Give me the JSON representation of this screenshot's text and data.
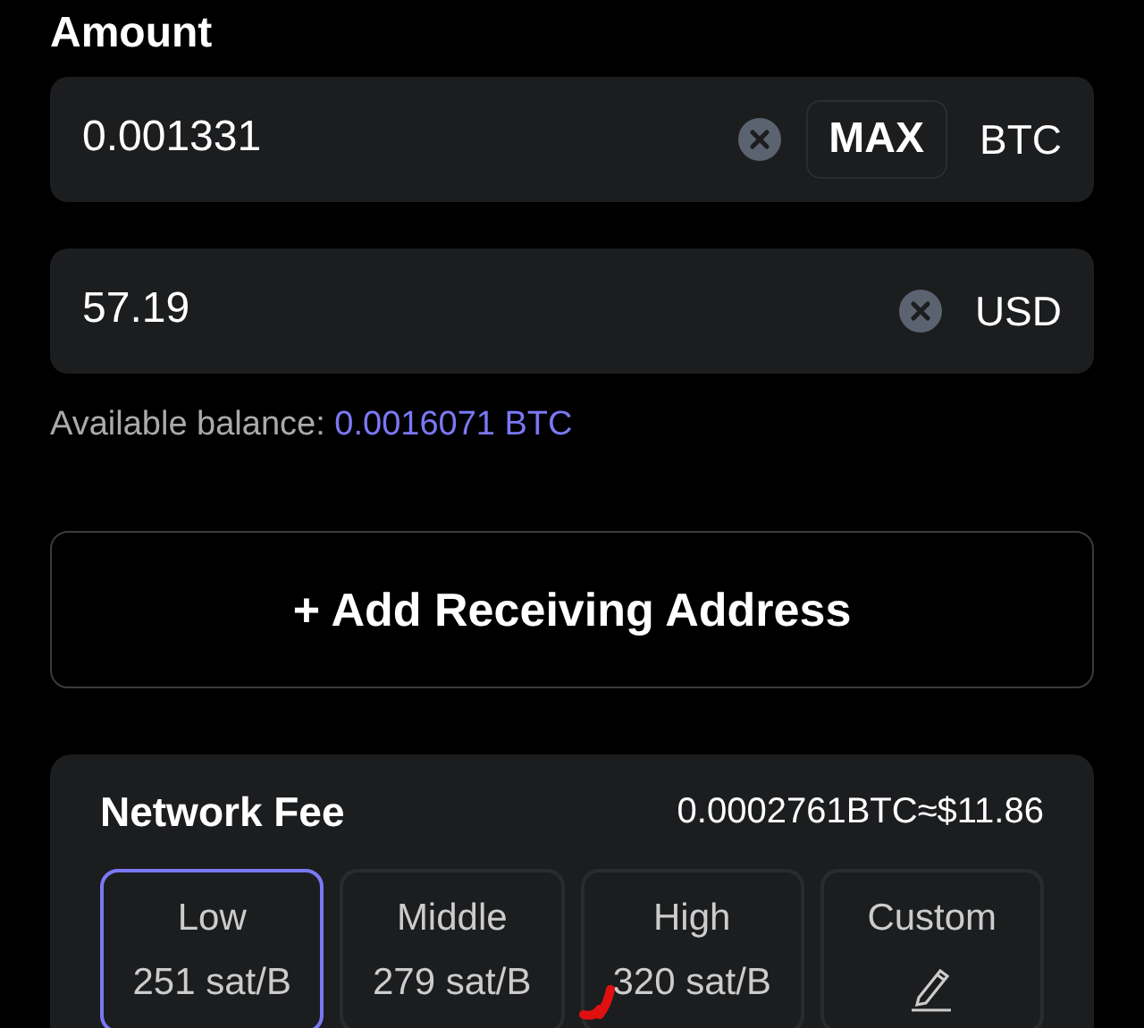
{
  "amount": {
    "title": "Amount",
    "fields": [
      {
        "value": "0.001331",
        "max_button": "MAX",
        "unit": "BTC"
      },
      {
        "value": "57.19",
        "unit": "USD"
      }
    ],
    "balance_label": "Available balance: ",
    "balance_value": "0.0016071 BTC"
  },
  "add_address_button": "+ Add Receiving Address",
  "network_fee": {
    "title": "Network Fee",
    "total": "0.0002761BTC≈$11.86",
    "options": [
      {
        "kind": "preset",
        "label": "Low",
        "rate": "251 sat/B",
        "selected": true
      },
      {
        "kind": "preset",
        "label": "Middle",
        "rate": "279 sat/B",
        "selected": false
      },
      {
        "kind": "preset",
        "label": "High",
        "rate": "320 sat/B",
        "selected": false
      },
      {
        "kind": "custom",
        "label": "Custom",
        "selected": false
      }
    ]
  }
}
